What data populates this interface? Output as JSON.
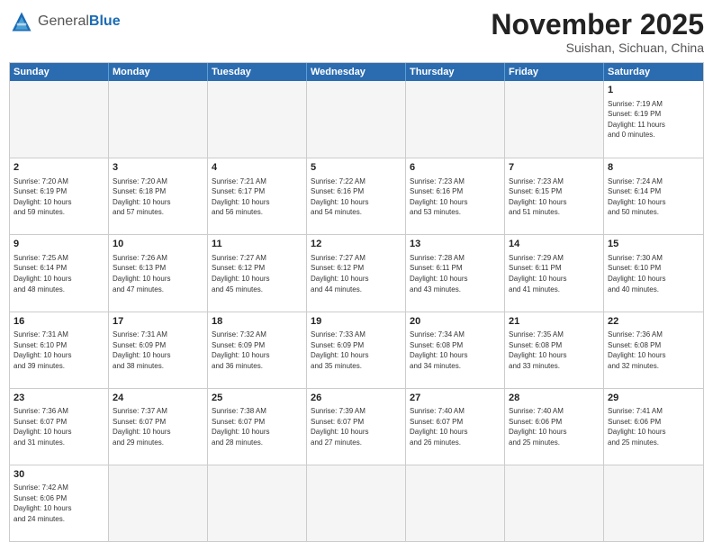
{
  "header": {
    "logo_general": "General",
    "logo_blue": "Blue",
    "month_title": "November 2025",
    "location": "Suishan, Sichuan, China"
  },
  "weekdays": [
    "Sunday",
    "Monday",
    "Tuesday",
    "Wednesday",
    "Thursday",
    "Friday",
    "Saturday"
  ],
  "weeks": [
    [
      {
        "day": "",
        "info": ""
      },
      {
        "day": "",
        "info": ""
      },
      {
        "day": "",
        "info": ""
      },
      {
        "day": "",
        "info": ""
      },
      {
        "day": "",
        "info": ""
      },
      {
        "day": "",
        "info": ""
      },
      {
        "day": "1",
        "info": "Sunrise: 7:19 AM\nSunset: 6:19 PM\nDaylight: 11 hours\nand 0 minutes."
      }
    ],
    [
      {
        "day": "2",
        "info": "Sunrise: 7:20 AM\nSunset: 6:19 PM\nDaylight: 10 hours\nand 59 minutes."
      },
      {
        "day": "3",
        "info": "Sunrise: 7:20 AM\nSunset: 6:18 PM\nDaylight: 10 hours\nand 57 minutes."
      },
      {
        "day": "4",
        "info": "Sunrise: 7:21 AM\nSunset: 6:17 PM\nDaylight: 10 hours\nand 56 minutes."
      },
      {
        "day": "5",
        "info": "Sunrise: 7:22 AM\nSunset: 6:16 PM\nDaylight: 10 hours\nand 54 minutes."
      },
      {
        "day": "6",
        "info": "Sunrise: 7:23 AM\nSunset: 6:16 PM\nDaylight: 10 hours\nand 53 minutes."
      },
      {
        "day": "7",
        "info": "Sunrise: 7:23 AM\nSunset: 6:15 PM\nDaylight: 10 hours\nand 51 minutes."
      },
      {
        "day": "8",
        "info": "Sunrise: 7:24 AM\nSunset: 6:14 PM\nDaylight: 10 hours\nand 50 minutes."
      }
    ],
    [
      {
        "day": "9",
        "info": "Sunrise: 7:25 AM\nSunset: 6:14 PM\nDaylight: 10 hours\nand 48 minutes."
      },
      {
        "day": "10",
        "info": "Sunrise: 7:26 AM\nSunset: 6:13 PM\nDaylight: 10 hours\nand 47 minutes."
      },
      {
        "day": "11",
        "info": "Sunrise: 7:27 AM\nSunset: 6:12 PM\nDaylight: 10 hours\nand 45 minutes."
      },
      {
        "day": "12",
        "info": "Sunrise: 7:27 AM\nSunset: 6:12 PM\nDaylight: 10 hours\nand 44 minutes."
      },
      {
        "day": "13",
        "info": "Sunrise: 7:28 AM\nSunset: 6:11 PM\nDaylight: 10 hours\nand 43 minutes."
      },
      {
        "day": "14",
        "info": "Sunrise: 7:29 AM\nSunset: 6:11 PM\nDaylight: 10 hours\nand 41 minutes."
      },
      {
        "day": "15",
        "info": "Sunrise: 7:30 AM\nSunset: 6:10 PM\nDaylight: 10 hours\nand 40 minutes."
      }
    ],
    [
      {
        "day": "16",
        "info": "Sunrise: 7:31 AM\nSunset: 6:10 PM\nDaylight: 10 hours\nand 39 minutes."
      },
      {
        "day": "17",
        "info": "Sunrise: 7:31 AM\nSunset: 6:09 PM\nDaylight: 10 hours\nand 38 minutes."
      },
      {
        "day": "18",
        "info": "Sunrise: 7:32 AM\nSunset: 6:09 PM\nDaylight: 10 hours\nand 36 minutes."
      },
      {
        "day": "19",
        "info": "Sunrise: 7:33 AM\nSunset: 6:09 PM\nDaylight: 10 hours\nand 35 minutes."
      },
      {
        "day": "20",
        "info": "Sunrise: 7:34 AM\nSunset: 6:08 PM\nDaylight: 10 hours\nand 34 minutes."
      },
      {
        "day": "21",
        "info": "Sunrise: 7:35 AM\nSunset: 6:08 PM\nDaylight: 10 hours\nand 33 minutes."
      },
      {
        "day": "22",
        "info": "Sunrise: 7:36 AM\nSunset: 6:08 PM\nDaylight: 10 hours\nand 32 minutes."
      }
    ],
    [
      {
        "day": "23",
        "info": "Sunrise: 7:36 AM\nSunset: 6:07 PM\nDaylight: 10 hours\nand 31 minutes."
      },
      {
        "day": "24",
        "info": "Sunrise: 7:37 AM\nSunset: 6:07 PM\nDaylight: 10 hours\nand 29 minutes."
      },
      {
        "day": "25",
        "info": "Sunrise: 7:38 AM\nSunset: 6:07 PM\nDaylight: 10 hours\nand 28 minutes."
      },
      {
        "day": "26",
        "info": "Sunrise: 7:39 AM\nSunset: 6:07 PM\nDaylight: 10 hours\nand 27 minutes."
      },
      {
        "day": "27",
        "info": "Sunrise: 7:40 AM\nSunset: 6:07 PM\nDaylight: 10 hours\nand 26 minutes."
      },
      {
        "day": "28",
        "info": "Sunrise: 7:40 AM\nSunset: 6:06 PM\nDaylight: 10 hours\nand 25 minutes."
      },
      {
        "day": "29",
        "info": "Sunrise: 7:41 AM\nSunset: 6:06 PM\nDaylight: 10 hours\nand 25 minutes."
      }
    ],
    [
      {
        "day": "30",
        "info": "Sunrise: 7:42 AM\nSunset: 6:06 PM\nDaylight: 10 hours\nand 24 minutes."
      },
      {
        "day": "",
        "info": ""
      },
      {
        "day": "",
        "info": ""
      },
      {
        "day": "",
        "info": ""
      },
      {
        "day": "",
        "info": ""
      },
      {
        "day": "",
        "info": ""
      },
      {
        "day": "",
        "info": ""
      }
    ]
  ]
}
